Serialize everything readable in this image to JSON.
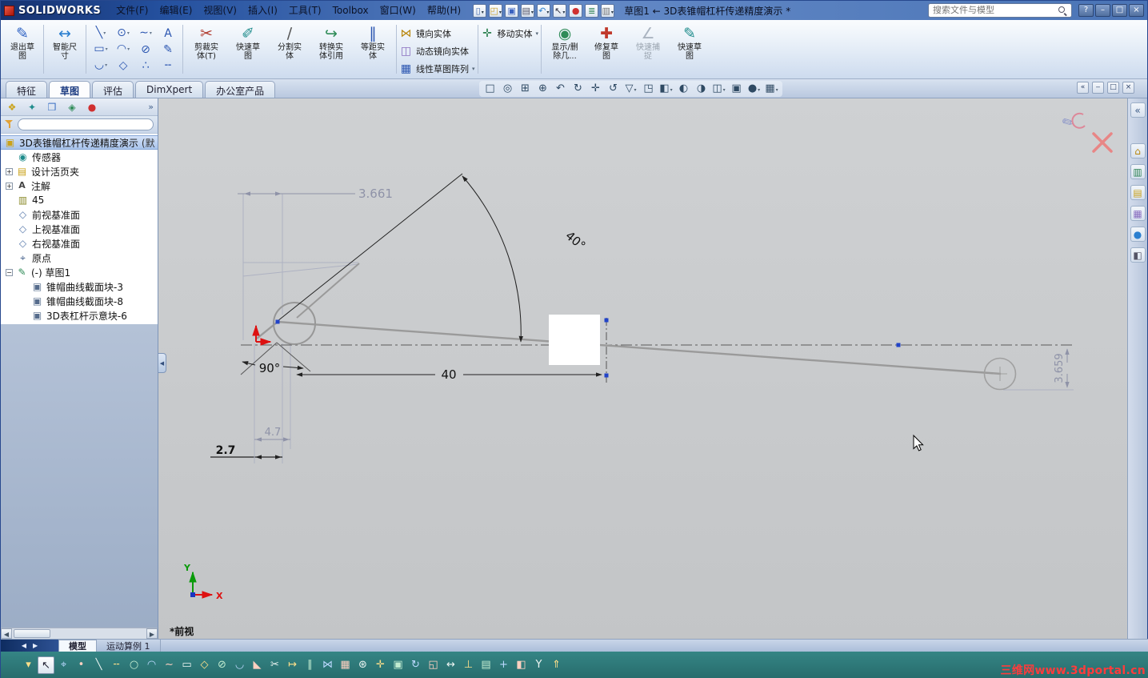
{
  "titlebar": {
    "app_name": "SOLIDWORKS",
    "menus": [
      "文件(F)",
      "编辑(E)",
      "视图(V)",
      "插入(I)",
      "工具(T)",
      "Toolbox",
      "窗口(W)",
      "帮助(H)"
    ],
    "quick_icons": [
      {
        "name": "new-document-icon",
        "glyph": "▯"
      },
      {
        "name": "open-icon",
        "glyph": "◰"
      },
      {
        "name": "save-icon",
        "glyph": "▣"
      },
      {
        "name": "print-icon",
        "glyph": "▤"
      },
      {
        "name": "undo-icon",
        "glyph": "↶"
      },
      {
        "name": "select-icon",
        "glyph": "↖"
      },
      {
        "name": "rebuild-icon",
        "glyph": "●"
      },
      {
        "name": "file-properties-icon",
        "glyph": "≣"
      },
      {
        "name": "options-icon",
        "glyph": "▥"
      }
    ],
    "doc_title": "草图1 ← 3D表锥帽杠杆传递精度演示 *",
    "search_placeholder": "搜索文件与模型",
    "window_buttons": {
      "help": "?",
      "minimize": "–",
      "restore": "□",
      "close": "×"
    }
  },
  "ribbon": {
    "exit_sketch": {
      "glyph": "✎",
      "line1": "退出草",
      "line2": "图"
    },
    "smart_dimension": {
      "glyph": "↔",
      "line1": "智能尺",
      "line2": "寸"
    },
    "entity_rows": [
      {
        "icons": [
          {
            "name": "line-tool-icon",
            "glyph": "╲"
          },
          {
            "name": "circle-tool-icon",
            "glyph": "⊙"
          },
          {
            "name": "spline-tool-icon",
            "glyph": "∼"
          },
          {
            "name": "text-tool-icon",
            "glyph": "A"
          }
        ]
      },
      {
        "icons": [
          {
            "name": "rectangle-tool-icon",
            "glyph": "▭"
          },
          {
            "name": "arc-tool-icon",
            "glyph": "◠"
          },
          {
            "name": "ellipse-tool-icon",
            "glyph": "⊘"
          },
          {
            "name": "pencil-tool-icon",
            "glyph": "✎"
          }
        ]
      },
      {
        "icons": [
          {
            "name": "fillet-tool-icon",
            "glyph": "◡"
          },
          {
            "name": "polygon-tool-icon",
            "glyph": "◇"
          },
          {
            "name": "point-tool-icon",
            "glyph": "∴"
          },
          {
            "name": "construction-line-icon",
            "glyph": "╌"
          }
        ]
      }
    ],
    "buttons": [
      {
        "line1": "剪裁实",
        "line2": "体(T)",
        "glyph": "✂"
      },
      {
        "line1": "快速草",
        "line2": "图",
        "glyph": "✐"
      },
      {
        "line1": "分割实",
        "line2": "体",
        "glyph": "∕"
      },
      {
        "line1": "转换实",
        "line2": "体引用",
        "glyph": "↪"
      },
      {
        "line1": "等距实",
        "line2": "体",
        "glyph": "∥"
      }
    ],
    "mirror_stack": [
      {
        "label": "镜向实体",
        "glyph": "⋈"
      },
      {
        "label": "动态镜向实体",
        "glyph": "◫"
      },
      {
        "label": "线性草图阵列",
        "glyph": "▦"
      }
    ],
    "move_stack": [
      {
        "label": "移动实体",
        "glyph": "✛"
      }
    ],
    "buttons2": [
      {
        "line1": "显示/删",
        "line2": "除几...",
        "glyph": "◉"
      },
      {
        "line1": "修复草",
        "line2": "图",
        "glyph": "✚"
      },
      {
        "line1": "快速捕",
        "line2": "捉",
        "glyph": "∠"
      },
      {
        "line1": "快速草",
        "line2": "图",
        "glyph": "✎"
      }
    ]
  },
  "tabs": [
    "特征",
    "草图",
    "评估",
    "DimXpert",
    "办公室产品"
  ],
  "headsup": [
    {
      "name": "screen-icon",
      "glyph": "□"
    },
    {
      "name": "zoom-fit-icon",
      "glyph": "◎"
    },
    {
      "name": "zoom-area-icon",
      "glyph": "⊞"
    },
    {
      "name": "zoom-in-out-icon",
      "glyph": "⊕"
    },
    {
      "name": "previous-view-icon",
      "glyph": "↶"
    },
    {
      "name": "rotate-view-icon",
      "glyph": "↻"
    },
    {
      "name": "pan-icon",
      "glyph": "✛"
    },
    {
      "name": "roll-view-icon",
      "glyph": "↺"
    },
    {
      "name": "view-orientation-icon",
      "glyph": "▽"
    },
    {
      "name": "standard-views-icon",
      "glyph": "◳"
    },
    {
      "name": "display-style-icon",
      "glyph": "◧"
    },
    {
      "name": "hide-show-items-icon",
      "glyph": "◐"
    },
    {
      "name": "shadow-view-icon",
      "glyph": "◑"
    },
    {
      "name": "section-view-icon",
      "glyph": "◫"
    },
    {
      "name": "camera-icon",
      "glyph": "▣"
    },
    {
      "name": "appearances-icon",
      "glyph": "●"
    },
    {
      "name": "scene-icon",
      "glyph": "▦"
    }
  ],
  "doc_controls": {
    "dock": "«",
    "minimize": "‒",
    "restore": "□",
    "close": "×"
  },
  "feature_tree": {
    "panel_tabs": [
      {
        "name": "featuremanager-tab-icon",
        "glyph": "❖"
      },
      {
        "name": "propertymanager-tab-icon",
        "glyph": "✦"
      },
      {
        "name": "configuration-tab-icon",
        "glyph": "❒"
      },
      {
        "name": "dimxpert-tab-icon",
        "glyph": "◈"
      },
      {
        "name": "display-manager-tab-icon",
        "glyph": "●"
      }
    ],
    "panel_tabs_more": "»",
    "root_glyph": "▣",
    "root_label": "3D表锥帽杠杆传递精度演示",
    "root_suffix": "(默",
    "items": [
      {
        "label": "传感器",
        "glyph": "◉"
      },
      {
        "label": "设计活页夹",
        "glyph": "▤",
        "expand": "+"
      },
      {
        "label": "注解",
        "glyph": "A",
        "expand": "+"
      },
      {
        "label": "45",
        "glyph": "▥"
      },
      {
        "label": "前视基准面",
        "glyph": "◇"
      },
      {
        "label": "上视基准面",
        "glyph": "◇"
      },
      {
        "label": "右视基准面",
        "glyph": "◇"
      },
      {
        "label": "原点",
        "glyph": "⌖"
      },
      {
        "label": "(-) 草图1",
        "glyph": "✎",
        "expand": "−"
      },
      {
        "label": "锥帽曲线截面块-3",
        "glyph": "▣"
      },
      {
        "label": "锥帽曲线截面块-8",
        "glyph": "▣"
      },
      {
        "label": "3D表杠杆示意块-6",
        "glyph": "▣"
      }
    ],
    "scroll_left": "◀",
    "scroll_right": "▶",
    "collapse_glyph": "◀"
  },
  "sketch": {
    "dim_top": "3.661",
    "dim_angle": "40°",
    "dim_pivot_angle": "90°",
    "dim_length": "40",
    "dim_mid": "4.7",
    "dim_small": "2.7",
    "dim_right": "3.659",
    "axis_x": "X",
    "axis_y": "Y",
    "view_label": "*前视"
  },
  "taskpane": [
    {
      "name": "taskpane-collapse-icon",
      "glyph": "«"
    },
    {
      "name": "resources-home-icon",
      "glyph": "⌂"
    },
    {
      "name": "design-library-icon",
      "glyph": "▥"
    },
    {
      "name": "file-explorer-icon",
      "glyph": "▤"
    },
    {
      "name": "view-palette-icon",
      "glyph": "▦"
    },
    {
      "name": "appearances-icon",
      "glyph": "●"
    },
    {
      "name": "custom-properties-icon",
      "glyph": "◧"
    }
  ],
  "bottom_tabs": {
    "scroll_left": "◀",
    "scroll_right": "▶",
    "model": "模型",
    "motion": "运动算例 1"
  },
  "statusbar": [
    {
      "name": "dropdown",
      "glyph": "▾"
    },
    {
      "name": "select",
      "glyph": "↖"
    },
    {
      "name": "snap",
      "glyph": "⌖"
    },
    {
      "name": "point",
      "glyph": "•"
    },
    {
      "name": "line",
      "glyph": "╲"
    },
    {
      "name": "centerline",
      "glyph": "╌"
    },
    {
      "name": "circle",
      "glyph": "○"
    },
    {
      "name": "arc",
      "glyph": "◠"
    },
    {
      "name": "spline",
      "glyph": "∼"
    },
    {
      "name": "rectangle",
      "glyph": "▭"
    },
    {
      "name": "polygon",
      "glyph": "◇"
    },
    {
      "name": "ellipse",
      "glyph": "⊘"
    },
    {
      "name": "fillet",
      "glyph": "◡"
    },
    {
      "name": "chamfer",
      "glyph": "◣"
    },
    {
      "name": "trim",
      "glyph": "✂"
    },
    {
      "name": "extend",
      "glyph": "↦"
    },
    {
      "name": "offset",
      "glyph": "∥"
    },
    {
      "name": "mirror",
      "glyph": "⋈"
    },
    {
      "name": "linear-pattern",
      "glyph": "▦"
    },
    {
      "name": "circular-pattern",
      "glyph": "⊛"
    },
    {
      "name": "move",
      "glyph": "✛"
    },
    {
      "name": "copy",
      "glyph": "▣"
    },
    {
      "name": "rotate",
      "glyph": "↻"
    },
    {
      "name": "scale",
      "glyph": "◱"
    },
    {
      "name": "dimension",
      "glyph": "↔"
    },
    {
      "name": "relation",
      "glyph": "⊥"
    },
    {
      "name": "grid",
      "glyph": "▤"
    },
    {
      "name": "origin",
      "glyph": "+"
    },
    {
      "name": "block",
      "glyph": "◧"
    },
    {
      "name": "split",
      "glyph": "Y"
    },
    {
      "name": "convert",
      "glyph": "⇑"
    }
  ],
  "watermark": "三维网www.3dportal.cn"
}
